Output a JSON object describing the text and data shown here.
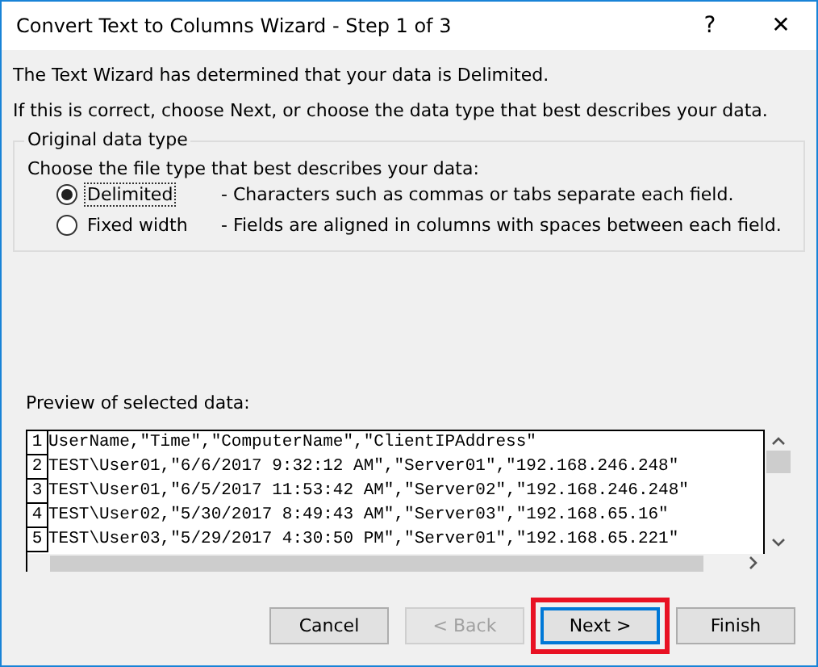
{
  "window": {
    "title": "Convert Text to Columns Wizard - Step 1 of 3",
    "help": "?",
    "close": "✕"
  },
  "intro": [
    "The Text Wizard has determined that your data is Delimited.",
    "If this is correct, choose Next, or choose the data type that best describes your data."
  ],
  "group": {
    "title": "Original data type",
    "prompt": "Choose the file type that best describes your data:",
    "options": [
      {
        "label": "Delimited",
        "description": "- Characters such as commas or tabs separate each field.",
        "selected": true
      },
      {
        "label": "Fixed width",
        "description": "- Fields are aligned in columns with spaces between each field.",
        "selected": false
      }
    ]
  },
  "preview": {
    "label": "Preview of selected data:",
    "rows": [
      {
        "number": "1",
        "text": "UserName,\"Time\",\"ComputerName\",\"ClientIPAddress\""
      },
      {
        "number": "2",
        "text": "TEST\\User01,\"6/6/2017 9:32:12 AM\",\"Server01\",\"192.168.246.248\""
      },
      {
        "number": "3",
        "text": "TEST\\User01,\"6/5/2017 11:53:42 AM\",\"Server02\",\"192.168.246.248\""
      },
      {
        "number": "4",
        "text": "TEST\\User02,\"5/30/2017 8:49:43 AM\",\"Server03\",\"192.168.65.16\""
      },
      {
        "number": "5",
        "text": "TEST\\User03,\"5/29/2017 4:30:50 PM\",\"Server01\",\"192.168.65.221\""
      }
    ]
  },
  "buttons": [
    {
      "label": "Cancel",
      "disabled": false,
      "default": false,
      "highlighted": false
    },
    {
      "label": "< Back",
      "disabled": true,
      "default": false,
      "highlighted": false
    },
    {
      "label": "Next >",
      "disabled": false,
      "default": true,
      "highlighted": true
    },
    {
      "label": "Finish",
      "disabled": false,
      "default": false,
      "highlighted": false
    }
  ]
}
